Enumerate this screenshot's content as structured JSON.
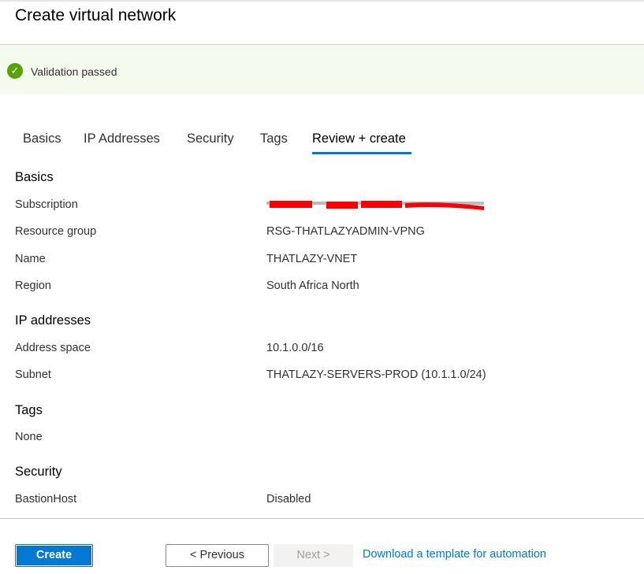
{
  "header": {
    "title": "Create virtual network"
  },
  "validation": {
    "icon": "check-circle-icon",
    "text": "Validation passed",
    "color": "#57a300"
  },
  "tabs": [
    {
      "label": "Basics"
    },
    {
      "label": "IP Addresses"
    },
    {
      "label": "Security"
    },
    {
      "label": "Tags"
    },
    {
      "label": "Review + create",
      "active": true
    }
  ],
  "sections": {
    "basics": {
      "title": "Basics",
      "subscription_label": "Subscription",
      "resource_group_label": "Resource group",
      "resource_group": "RSG-THATLAZYADMIN-VPNG",
      "name_label": "Name",
      "name": "THATLAZY-VNET",
      "region_label": "Region",
      "region": "South Africa North"
    },
    "ip": {
      "title": "IP addresses",
      "address_space_label": "Address space",
      "address_space": "10.1.0.0/16",
      "subnet_label": "Subnet",
      "subnet": "THATLAZY-SERVERS-PROD (10.1.1.0/24)"
    },
    "tags": {
      "title": "Tags",
      "none": "None"
    },
    "security": {
      "title": "Security",
      "bastion_label": "BastionHost",
      "bastion": "Disabled"
    }
  },
  "footer": {
    "create": "Create",
    "previous": "< Previous",
    "next": "Next >",
    "download_link": "Download a template for automation"
  },
  "colors": {
    "accent": "#0078d4",
    "banner_bg": "#f4fbee",
    "redaction": "#ff0000"
  }
}
